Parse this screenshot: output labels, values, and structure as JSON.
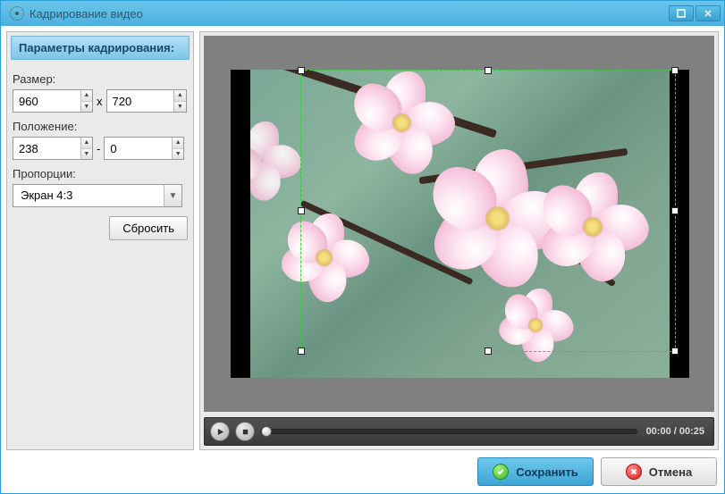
{
  "window": {
    "title": "Кадрирование видео"
  },
  "panel": {
    "header": "Параметры кадрирования:",
    "size_label": "Размер:",
    "size_w": "960",
    "size_sep": "x",
    "size_h": "720",
    "pos_label": "Положение:",
    "pos_x": "238",
    "pos_sep": "-",
    "pos_y": "0",
    "aspect_label": "Пропорции:",
    "aspect_value": "Экран 4:3",
    "reset_label": "Сбросить"
  },
  "player": {
    "timecode": "00:00 / 00:25"
  },
  "buttons": {
    "save": "Сохранить",
    "cancel": "Отмена"
  }
}
